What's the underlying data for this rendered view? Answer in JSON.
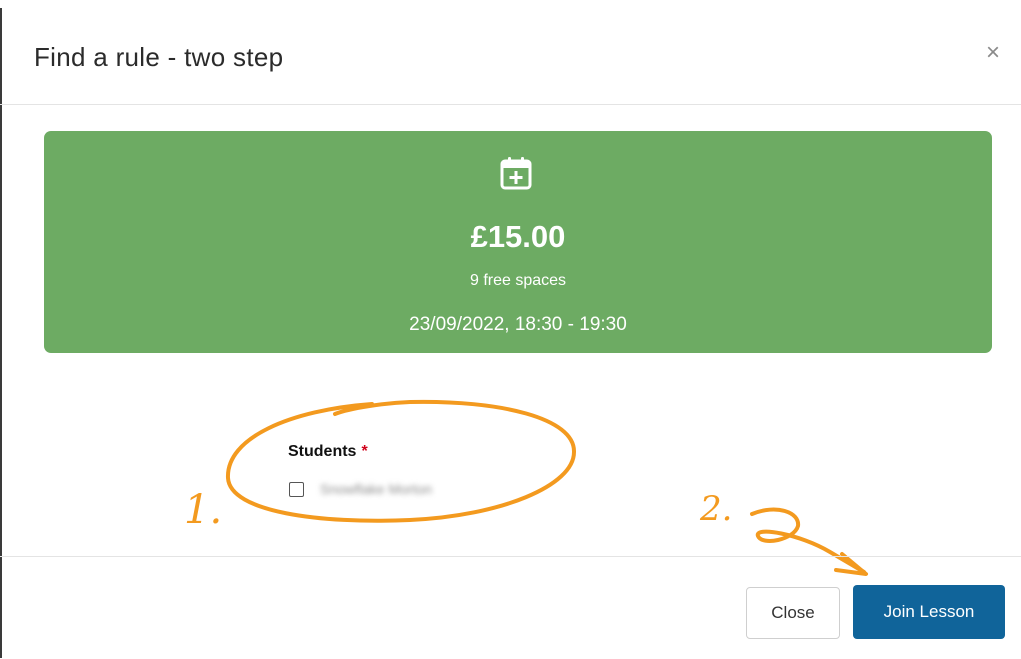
{
  "modal": {
    "title": "Find a rule - two step",
    "close_glyph": "×"
  },
  "lesson": {
    "icon": "calendar-plus-icon",
    "price": "£15.00",
    "spaces": "9 free spaces",
    "datetime": "23/09/2022, 18:30 - 19:30",
    "card_color": "#6dab63"
  },
  "form": {
    "students_label": "Students",
    "required_marker": "*",
    "students": [
      {
        "name": "Snowflake Morton",
        "checked": false
      }
    ]
  },
  "footer": {
    "close_label": "Close",
    "join_label": "Join Lesson",
    "primary_color": "#10649a"
  },
  "annotations": {
    "step1_label": "1.",
    "step2_label": "2.",
    "ink_color": "#f39a1f"
  }
}
